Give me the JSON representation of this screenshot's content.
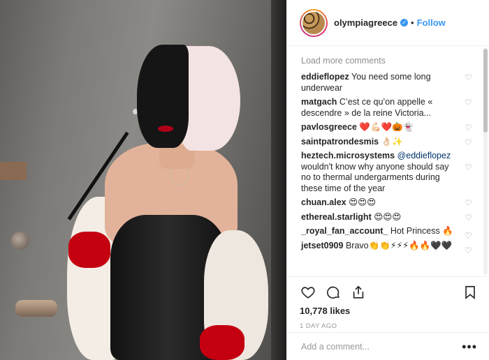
{
  "post": {
    "username": "olympiagreece",
    "separator": "•",
    "follow_label": "Follow",
    "verified_icon": "verified-badge-icon"
  },
  "comments": {
    "load_more": "Load more comments",
    "items": [
      {
        "user": "eddieflopez",
        "text": "You need some long underwear"
      },
      {
        "user": "matgach",
        "text": "C’est ce qu’on appelle « descendre » de la reine Victoria..."
      },
      {
        "user": "pavlosgreece",
        "text": "❤️💪🏻❤️🎃👻"
      },
      {
        "user": "saintpatrondesmis",
        "text": "👌🏻✨"
      },
      {
        "user": "heztech.microsystems",
        "mention": "@eddieflopez",
        "text": "wouldn't know why anyone should say no to thermal undergarments during these time of the year"
      },
      {
        "user": "chuan.alex",
        "text": "😍😍😍"
      },
      {
        "user": "ethereal.starlight",
        "text": "😍😍😍"
      },
      {
        "user": "_royal_fan_account_",
        "text": "Hot Princess 🔥"
      },
      {
        "user": "jetset0909",
        "text": "Bravo👏👏⚡⚡⚡🔥🔥🖤🖤"
      }
    ]
  },
  "actions": {
    "likes": "10,778 likes",
    "time": "1 DAY AGO",
    "icons": [
      "heart-icon",
      "comment-icon",
      "share-icon",
      "bookmark-icon"
    ]
  },
  "add_comment": {
    "placeholder": "Add a comment...",
    "more_label": "•••"
  },
  "colors": {
    "link_blue": "#3897f0",
    "mention_blue": "#003569",
    "text": "#262626",
    "muted": "#8e8e8e"
  }
}
